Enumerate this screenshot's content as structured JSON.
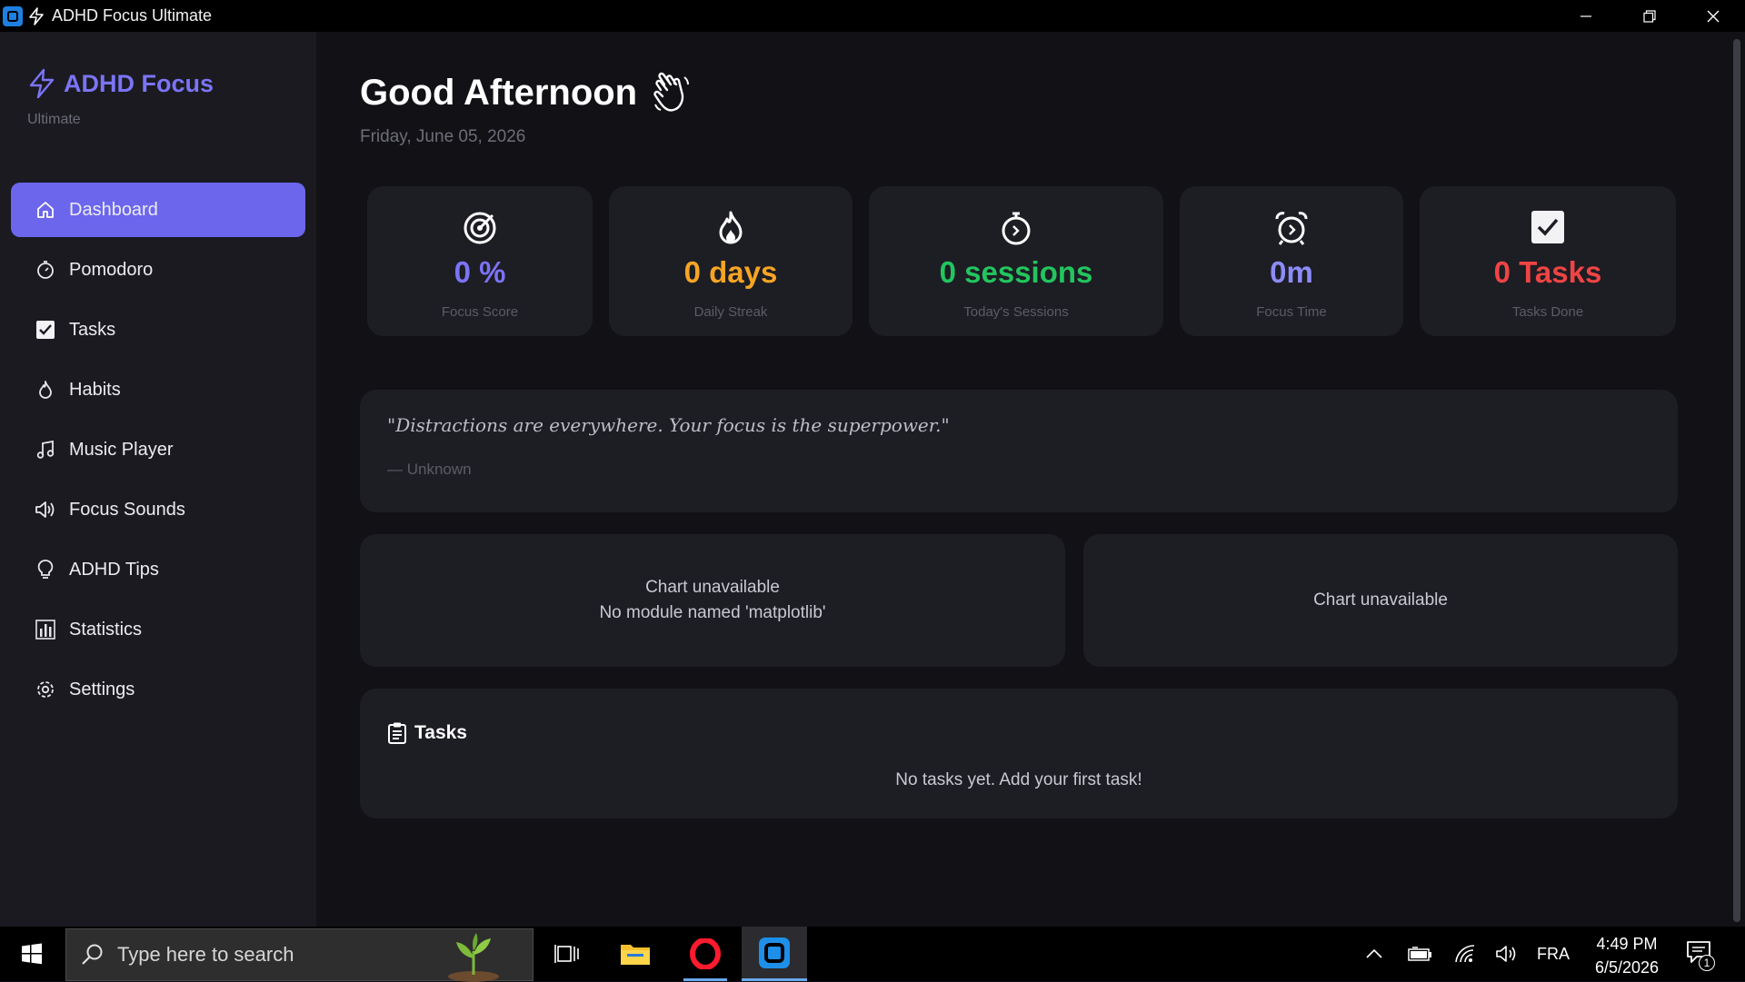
{
  "window": {
    "title": "ADHD Focus Ultimate"
  },
  "brand": {
    "name": "ADHD Focus",
    "subtitle": "Ultimate",
    "accent": "#7b74f5"
  },
  "sidebar": {
    "items": [
      {
        "label": "Dashboard",
        "icon": "home-icon",
        "active": true
      },
      {
        "label": "Pomodoro",
        "icon": "timer-icon"
      },
      {
        "label": "Tasks",
        "icon": "checkbox-icon"
      },
      {
        "label": "Habits",
        "icon": "flame-icon"
      },
      {
        "label": "Music Player",
        "icon": "music-note-icon"
      },
      {
        "label": "Focus Sounds",
        "icon": "speaker-icon"
      },
      {
        "label": "ADHD Tips",
        "icon": "lightbulb-icon"
      },
      {
        "label": "Statistics",
        "icon": "bar-chart-icon"
      },
      {
        "label": "Settings",
        "icon": "gear-icon"
      }
    ]
  },
  "header": {
    "greeting": "Good Afternoon",
    "date": "Friday, June 05, 2026"
  },
  "stats": [
    {
      "value": "0 %",
      "label": "Focus Score",
      "color": "#7b74f5",
      "icon": "target-icon"
    },
    {
      "value": "0 days",
      "label": "Daily Streak",
      "color": "#f5a524",
      "icon": "flame-icon"
    },
    {
      "value": "0 sessions",
      "label": "Today's Sessions",
      "color": "#22c55e",
      "icon": "stopwatch-icon"
    },
    {
      "value": "0m",
      "label": "Focus Time",
      "color": "#8b8cf7",
      "icon": "alarm-clock-icon"
    },
    {
      "value": "0 Tasks",
      "label": "Tasks Done",
      "color": "#ef4444",
      "icon": "check-box-icon"
    }
  ],
  "quote": {
    "text": "\"Distractions are everywhere. Your focus is the superpower.\"",
    "author": "— Unknown"
  },
  "charts": [
    {
      "line1": "Chart unavailable",
      "line2": "No module named 'matplotlib'"
    },
    {
      "line1": "Chart unavailable"
    }
  ],
  "tasks": {
    "title": "Tasks",
    "empty": "No tasks yet. Add your first task!"
  },
  "taskbar": {
    "search_placeholder": "Type here to search",
    "language": "FRA",
    "time": "4:49 PM",
    "date": "6/5/2026",
    "notifications": "1"
  }
}
